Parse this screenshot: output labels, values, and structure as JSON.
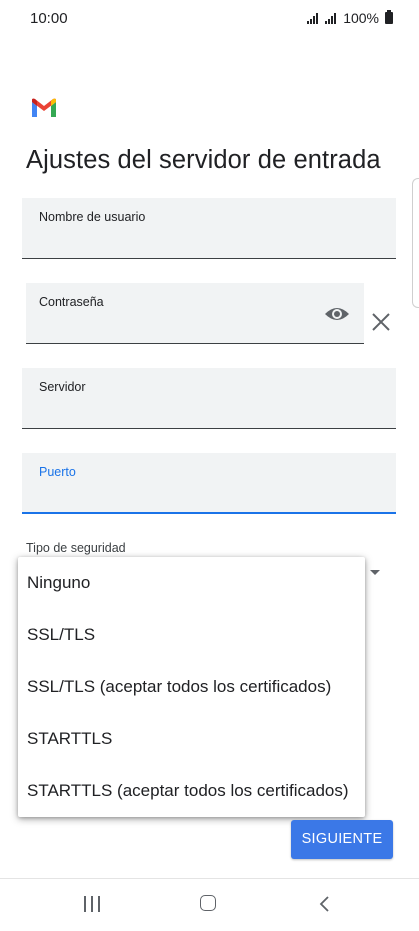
{
  "status_bar": {
    "time": "10:00",
    "battery": "100%"
  },
  "app": {
    "logo": "gmail-logo-icon",
    "title": "Ajustes del servidor de entrada"
  },
  "form": {
    "username_label": "Nombre de usuario",
    "password_label": "Contraseña",
    "server_label": "Servidor",
    "port_label": "Puerto",
    "security_label": "Tipo de seguridad"
  },
  "security_menu": {
    "options": [
      "Ninguno",
      "SSL/TLS",
      "SSL/TLS (aceptar todos los certificados)",
      "STARTTLS",
      "STARTTLS (aceptar todos los certificados)"
    ]
  },
  "buttons": {
    "next": "SIGUIENTE"
  },
  "colors": {
    "accent": "#1a73e8",
    "button": "#3b78e7",
    "field_bg": "#f1f3f4"
  }
}
